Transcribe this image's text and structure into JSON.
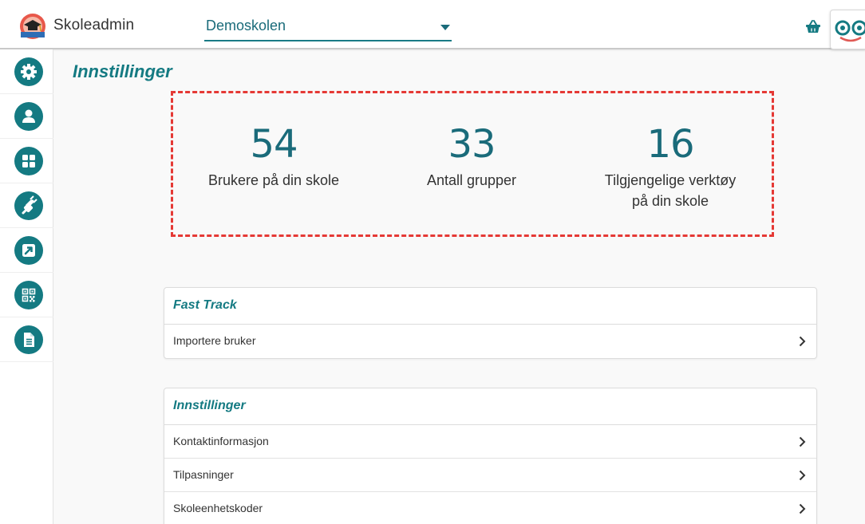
{
  "header": {
    "app_name": "Skoleadmin",
    "school_selected": "Demoskolen"
  },
  "sidebar": {
    "items": [
      {
        "icon": "gear-icon"
      },
      {
        "icon": "user-icon"
      },
      {
        "icon": "apps-grid-icon"
      },
      {
        "icon": "plug-icon"
      },
      {
        "icon": "external-link-icon"
      },
      {
        "icon": "qr-code-icon"
      },
      {
        "icon": "document-icon"
      }
    ]
  },
  "page_title": "Innstillinger",
  "stats": [
    {
      "value": "54",
      "label": "Brukere på din skole"
    },
    {
      "value": "33",
      "label": "Antall grupper"
    },
    {
      "value": "16",
      "label": "Tilgjengelige verktøy\npå din skole"
    }
  ],
  "cards": {
    "fast_track": {
      "title": "Fast Track",
      "rows": [
        "Importere bruker"
      ]
    },
    "settings": {
      "title": "Innstillinger",
      "rows": [
        "Kontaktinformasjon",
        "Tilpasninger",
        "Skoleenhetskoder"
      ]
    }
  },
  "colors": {
    "accent": "#147a82",
    "highlight_border": "#e53935"
  }
}
